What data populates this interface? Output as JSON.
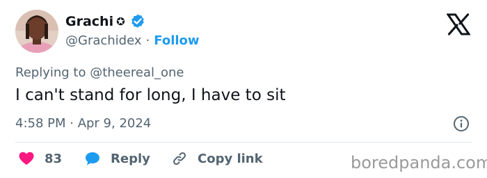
{
  "user": {
    "display_name": "Grachi",
    "name_symbol": "✪",
    "handle": "@Grachidex",
    "separator": "·",
    "follow_label": "Follow"
  },
  "tweet": {
    "replying_prefix": "Replying to",
    "replying_handle": "@theereal_one",
    "text": "I can't stand for long, I have to sit",
    "timestamp": "4:58 PM · Apr 9, 2024"
  },
  "actions": {
    "like_count": "83",
    "reply_label": "Reply",
    "copy_label": "Copy link"
  },
  "watermark": "boredpanda.com",
  "colors": {
    "accent": "#1d9bf0",
    "like": "#f91880",
    "text": "#0f1419",
    "muted": "#536471"
  },
  "icons": [
    "avatar",
    "verified-badge-icon",
    "x-logo-icon",
    "info-icon",
    "heart-icon",
    "reply-bubble-icon",
    "link-icon"
  ]
}
